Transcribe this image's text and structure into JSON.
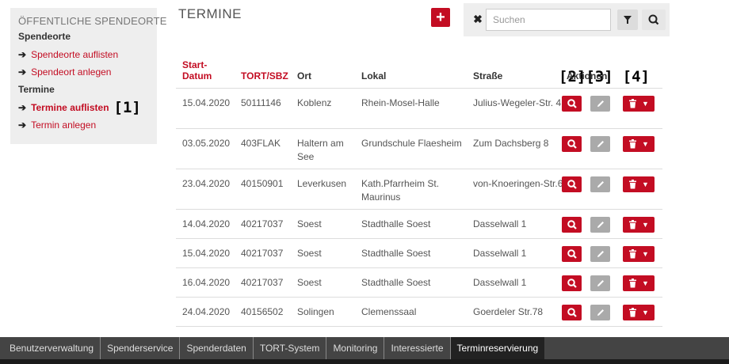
{
  "sidebar": {
    "heading": "ÖFFENTLICHE SPENDEORTE",
    "groups": [
      {
        "label": "Spendeorte",
        "items": [
          "Spendeorte auflisten",
          "Spendeort anlegen"
        ]
      },
      {
        "label": "Termine",
        "items": [
          "Termine auflisten",
          "Termin anlegen"
        ]
      }
    ],
    "marker1": "[1]"
  },
  "main": {
    "title": "TERMINE",
    "add_symbol": "+",
    "search": {
      "placeholder": "Suchen",
      "value": ""
    }
  },
  "table": {
    "headers": {
      "start": "Start-\nDatum",
      "tort": "TORT/SBZ",
      "ort": "Ort",
      "lokal": "Lokal",
      "strasse": "Straße",
      "aktionen": "Aktionen"
    },
    "markers": [
      "[2]",
      "[3]",
      "[4]"
    ],
    "rows": [
      {
        "datum": "15.04.2020",
        "tort": "50111146",
        "ort": "Koblenz",
        "lokal": "Rhein-Mosel-Halle",
        "strasse": "Julius-Wegeler-Str. 4"
      },
      {
        "datum": "03.05.2020",
        "tort": "403FLAK",
        "ort": "Haltern am See",
        "lokal": "Grundschule Flaesheim",
        "strasse": "Zum Dachsberg 8"
      },
      {
        "datum": "23.04.2020",
        "tort": "40150901",
        "ort": "Leverkusen",
        "lokal": "Kath.Pfarrheim St. Maurinus",
        "strasse": "von-Knoeringen-Str.6"
      },
      {
        "datum": "14.04.2020",
        "tort": "40217037",
        "ort": "Soest",
        "lokal": "Stadthalle Soest",
        "strasse": "Dasselwall 1"
      },
      {
        "datum": "15.04.2020",
        "tort": "40217037",
        "ort": "Soest",
        "lokal": "Stadthalle Soest",
        "strasse": "Dasselwall 1"
      },
      {
        "datum": "16.04.2020",
        "tort": "40217037",
        "ort": "Soest",
        "lokal": "Stadthalle Soest",
        "strasse": "Dasselwall 1"
      },
      {
        "datum": "24.04.2020",
        "tort": "40156502",
        "ort": "Solingen",
        "lokal": "Clemenssaal",
        "strasse": "Goerdeler Str.78"
      }
    ]
  },
  "bottom_tabs": [
    "Benutzerverwaltung",
    "Spenderservice",
    "Spenderdaten",
    "TORT-System",
    "Monitoring",
    "Interessierte",
    "Terminreservierung"
  ],
  "active_tab": "Terminreservierung",
  "colors": {
    "accent": "#c30d23",
    "edit": "#aaaaaa",
    "bar": "#444444"
  }
}
